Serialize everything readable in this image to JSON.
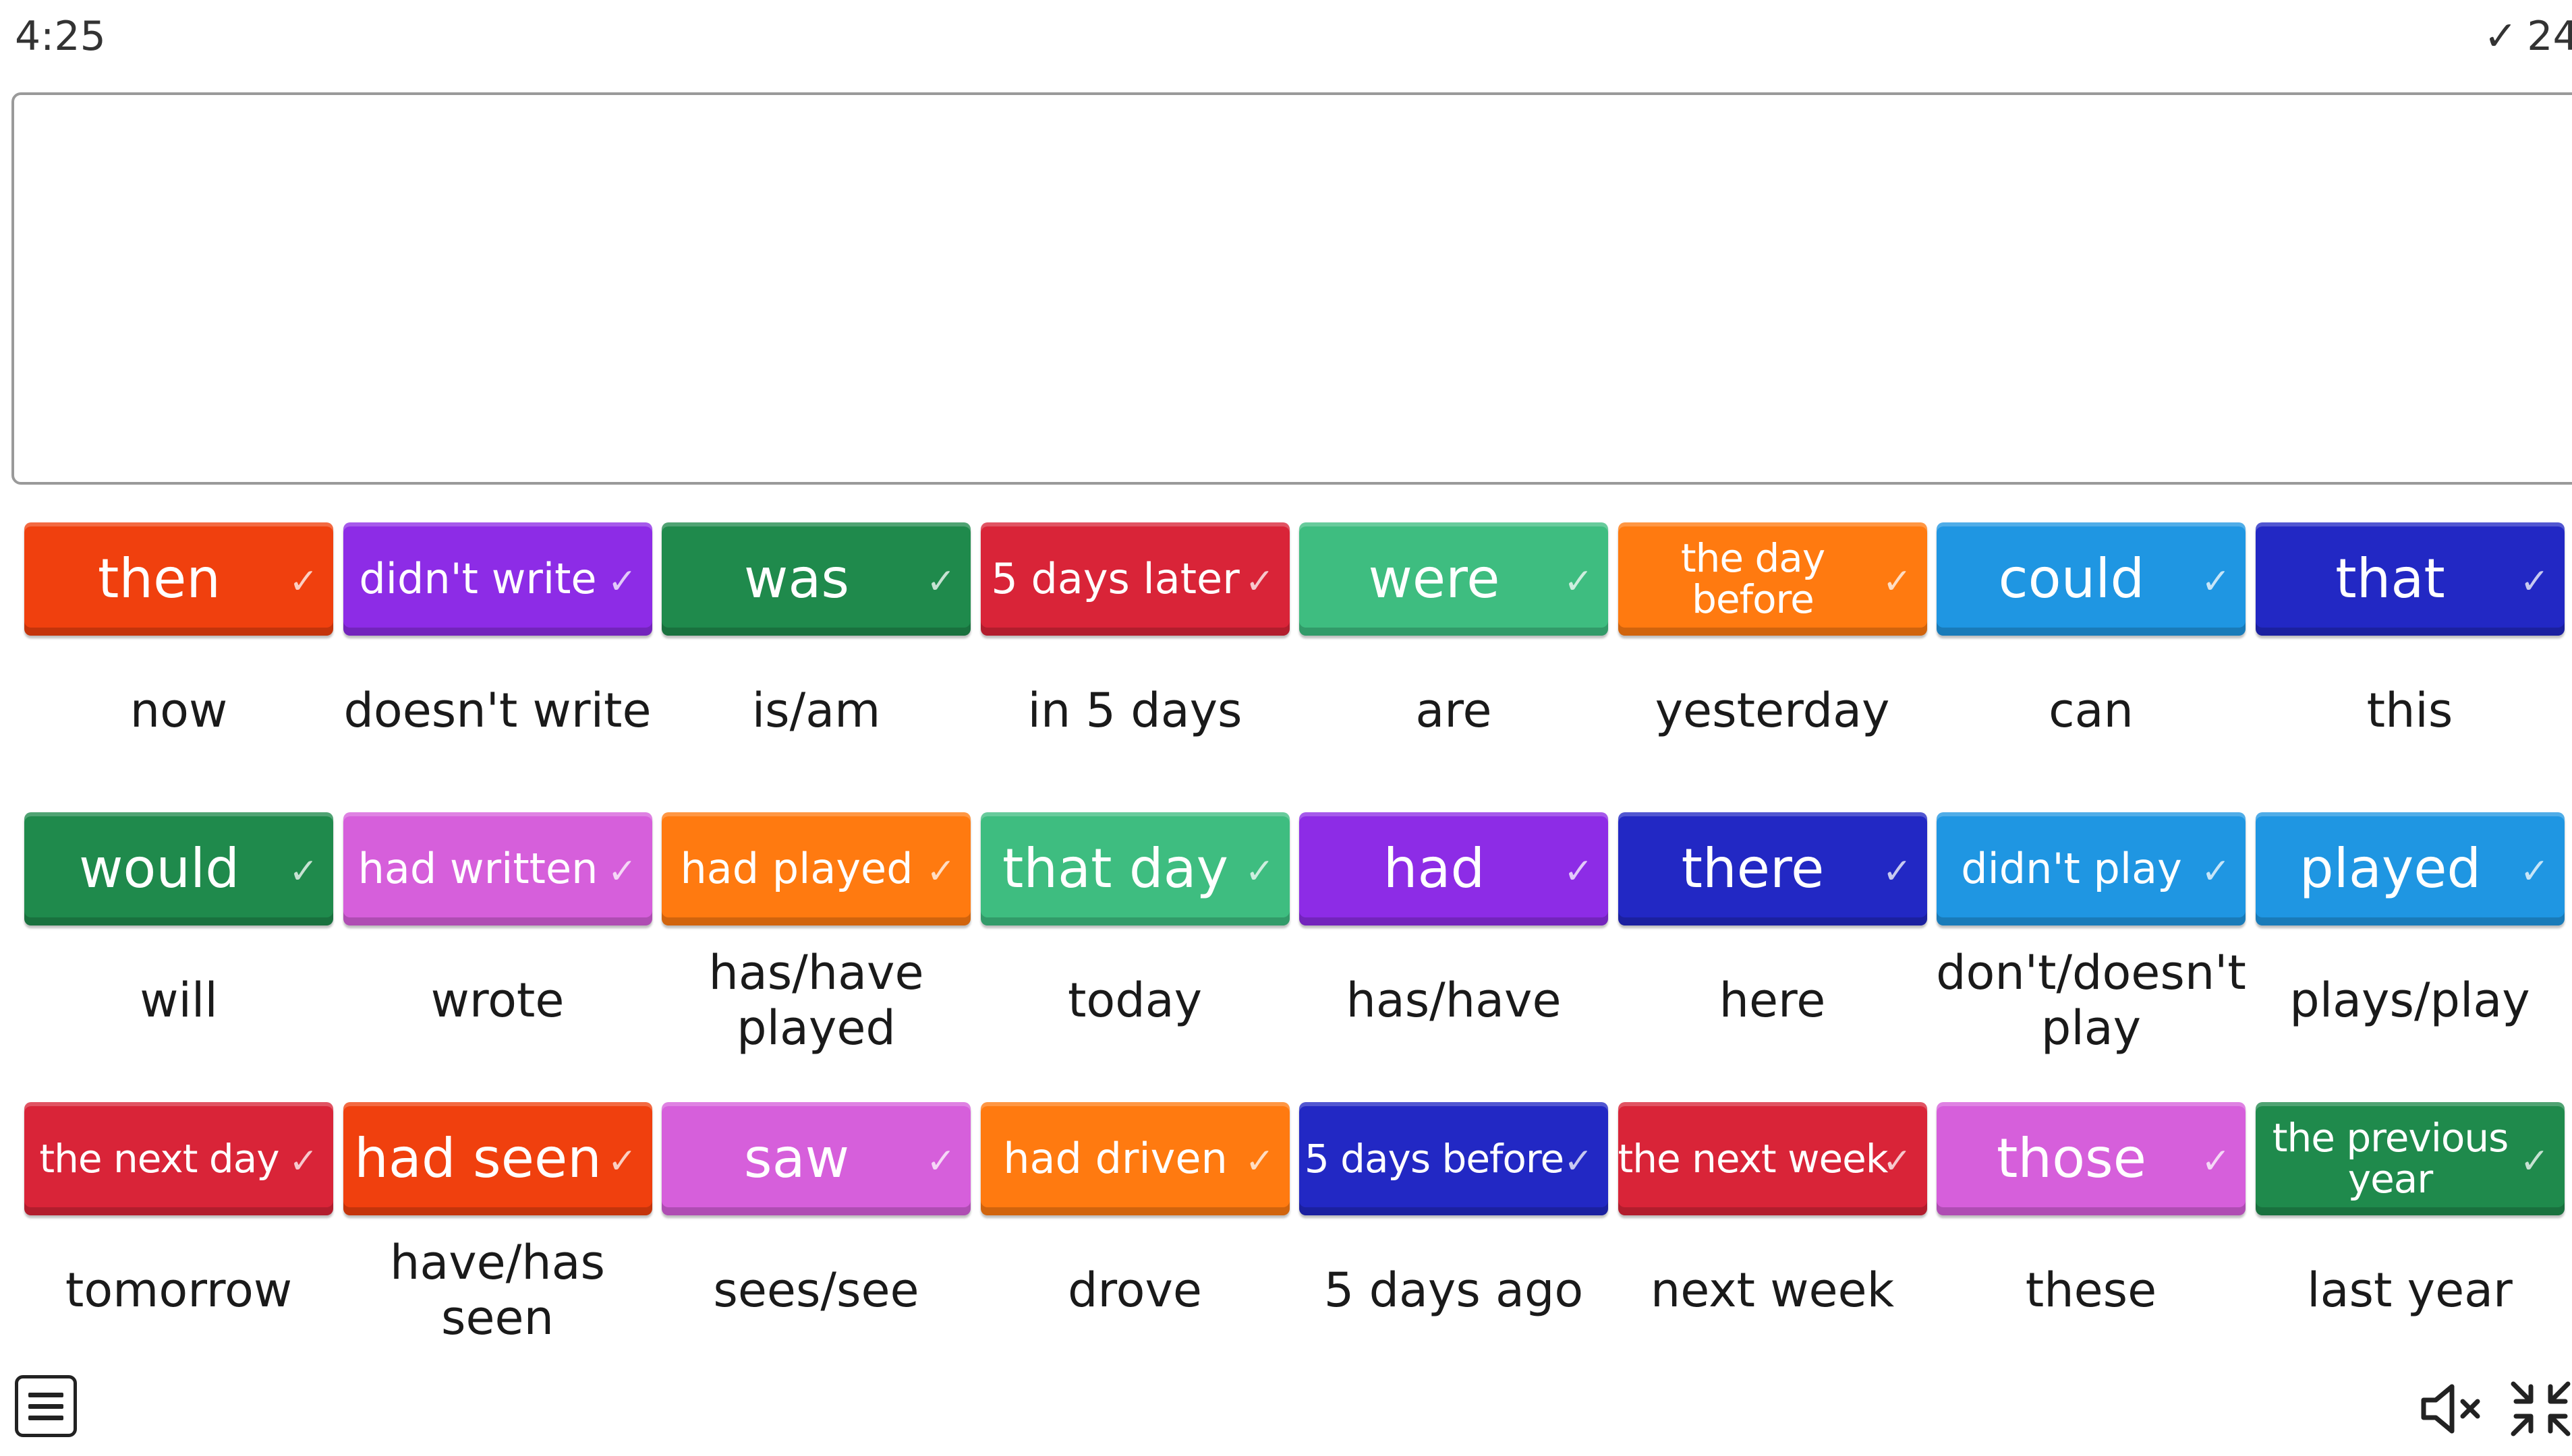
{
  "header": {
    "timer": "4:25",
    "score_check": "✓",
    "score": "24"
  },
  "answer_area": {
    "content": ""
  },
  "colors": {
    "red_orange": "#f0400e",
    "purple": "#8d2ce6",
    "dark_green": "#1f8a4c",
    "crimson": "#d92438",
    "mint": "#3ebd80",
    "orange": "#ff7a10",
    "sky_blue": "#1f96e2",
    "navy": "#2228c4",
    "pink_purple": "#d65fdb"
  },
  "tiles": [
    {
      "label": "then",
      "answer": "now",
      "color": "#f0400e",
      "size": "big"
    },
    {
      "label": "didn't write",
      "answer": "doesn't write",
      "color": "#8d2ce6",
      "size": "mid"
    },
    {
      "label": "was",
      "answer": "is/am",
      "color": "#1f8a4c",
      "size": "big"
    },
    {
      "label": "5 days later",
      "answer": "in 5 days",
      "color": "#d92438",
      "size": "mid"
    },
    {
      "label": "were",
      "answer": "are",
      "color": "#3ebd80",
      "size": "big"
    },
    {
      "label": "the day before",
      "answer": "yesterday",
      "color": "#ff7a10",
      "size": "small"
    },
    {
      "label": "could",
      "answer": "can",
      "color": "#1f96e2",
      "size": "big"
    },
    {
      "label": "that",
      "answer": "this",
      "color": "#2228c4",
      "size": "big"
    },
    {
      "label": "would",
      "answer": "will",
      "color": "#1f8a4c",
      "size": "big"
    },
    {
      "label": "had written",
      "answer": "wrote",
      "color": "#d65fdb",
      "size": "mid"
    },
    {
      "label": "had played",
      "answer": "has/have played",
      "color": "#ff7a10",
      "size": "mid"
    },
    {
      "label": "that day",
      "answer": "today",
      "color": "#3ebd80",
      "size": "big"
    },
    {
      "label": "had",
      "answer": "has/have",
      "color": "#8d2ce6",
      "size": "big"
    },
    {
      "label": "there",
      "answer": "here",
      "color": "#2228c4",
      "size": "big"
    },
    {
      "label": "didn't play",
      "answer": "don't/doesn't play",
      "color": "#1f96e2",
      "size": "mid"
    },
    {
      "label": "played",
      "answer": "plays/play",
      "color": "#1f96e2",
      "size": "big"
    },
    {
      "label": "the next day",
      "answer": "tomorrow",
      "color": "#d92438",
      "size": "small"
    },
    {
      "label": "had seen",
      "answer": "have/has seen",
      "color": "#f0400e",
      "size": "big"
    },
    {
      "label": "saw",
      "answer": "sees/see",
      "color": "#d65fdb",
      "size": "big"
    },
    {
      "label": "had driven",
      "answer": "drove",
      "color": "#ff7a10",
      "size": "mid"
    },
    {
      "label": "5 days before",
      "answer": "5 days ago",
      "color": "#2228c4",
      "size": "small"
    },
    {
      "label": "the next week",
      "answer": "next week",
      "color": "#d92438",
      "size": "small"
    },
    {
      "label": "those",
      "answer": "these",
      "color": "#d65fdb",
      "size": "big"
    },
    {
      "label": "the previous year",
      "answer": "last year",
      "color": "#1f8a4c",
      "size": "small"
    }
  ],
  "footer": {
    "menu_icon": "menu-icon",
    "mute_icon": "speaker-muted-icon",
    "collapse_icon": "collapse-fullscreen-icon"
  }
}
